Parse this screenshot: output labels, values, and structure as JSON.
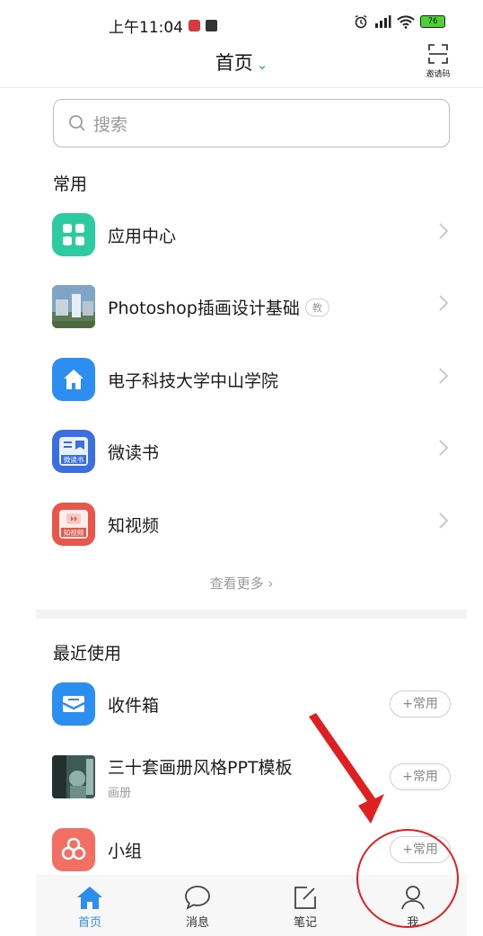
{
  "status_bar": {
    "time": "上午11:04",
    "battery": "76"
  },
  "header": {
    "title": "首页",
    "invite_label": "邀请码"
  },
  "search": {
    "placeholder": "搜索"
  },
  "frequent": {
    "title": "常用",
    "items": [
      {
        "label": "应用中心",
        "icon": "grid-icon",
        "color": "#2dcba0"
      },
      {
        "label": "Photoshop插画设计基础",
        "tag": "教",
        "icon": "course-thumbnail"
      },
      {
        "label": "电子科技大学中山学院",
        "icon": "home-icon",
        "color": "#2b8ef0"
      },
      {
        "label": "微读书",
        "icon": "book-icon",
        "color": "#3b6fe0",
        "icon_text": "微读书"
      },
      {
        "label": "知视频",
        "icon": "video-icon",
        "color": "#e8574a",
        "icon_text": "知视频"
      }
    ],
    "more": "查看更多"
  },
  "recent": {
    "title": "最近使用",
    "items": [
      {
        "label": "收件箱",
        "action": "+常用",
        "icon": "inbox-icon",
        "color": "#2b8ef0"
      },
      {
        "label": "三十套画册风格PPT模板",
        "sub": "画册",
        "action": "+常用",
        "icon": "album-thumbnail"
      },
      {
        "label": "小组",
        "action": "+常用",
        "icon": "group-icon",
        "color": "#f26f63"
      }
    ]
  },
  "tabs": [
    {
      "label": "首页",
      "icon": "home-tab-icon",
      "active": true
    },
    {
      "label": "消息",
      "icon": "chat-bubble-icon"
    },
    {
      "label": "笔记",
      "icon": "note-edit-icon"
    },
    {
      "label": "我",
      "icon": "person-icon"
    }
  ],
  "colors": {
    "accent": "#2b8ef0",
    "annotation": "#e02020"
  }
}
